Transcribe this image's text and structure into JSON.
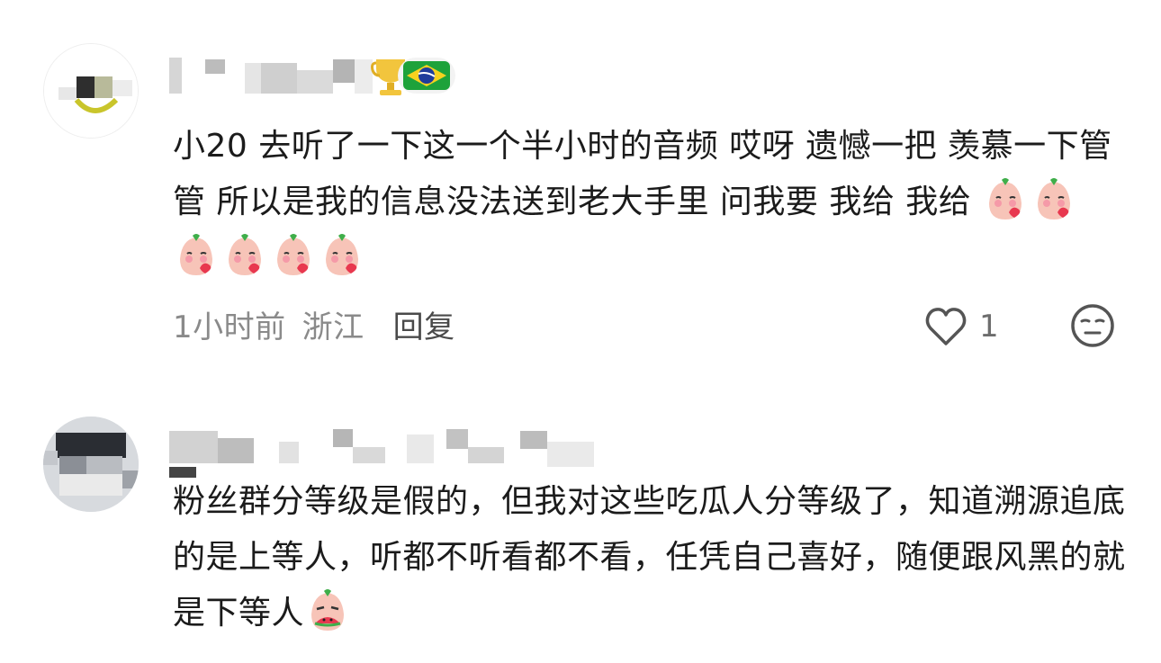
{
  "comments": [
    {
      "text": "小20 去听了一下这一个半小时的音频 哎呀 遗憾一把 羡慕一下管管 所以是我的信息没法送到老大手里 问我要 我给 我给",
      "emojis": [
        "blush-kiss-emoji",
        "blush-kiss-emoji",
        "blush-kiss-emoji",
        "blush-kiss-emoji",
        "blush-kiss-emoji",
        "blush-kiss-emoji"
      ],
      "time": "1小时前",
      "location": "浙江",
      "reply_label": "回复",
      "like_count": "1",
      "icons": {
        "like": "heart-icon",
        "dislike": "neutral-face-icon"
      }
    },
    {
      "text": "粉丝群分等级是假的，但我对这些吃瓜人分等级了，知道溯源追底的是上等人，听都不听看都不看，任凭自己喜好，随便跟风黑的就是下等人",
      "emojis": [
        "eating-watermelon-emoji"
      ]
    }
  ],
  "colors": {
    "text": "#1b1b1b",
    "meta": "#8a8a8a",
    "emoji_skin": "#f7c4b8",
    "emoji_leaf": "#3fae4a",
    "heart_red": "#e8384f"
  }
}
